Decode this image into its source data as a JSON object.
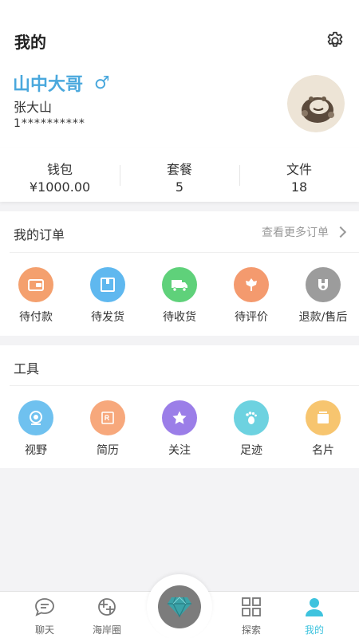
{
  "header": {
    "title": "我的",
    "settings_icon": "gear-icon"
  },
  "profile": {
    "nickname": "山中大哥",
    "gender_symbol": "♂",
    "name": "张大山",
    "phone": "1**********",
    "avatar_icon": "avatar"
  },
  "stats": [
    {
      "label": "钱包",
      "value": "¥1000.00"
    },
    {
      "label": "套餐",
      "value": "5"
    },
    {
      "label": "文件",
      "value": "18"
    }
  ],
  "orders": {
    "title": "我的订单",
    "more_label": "查看更多订单",
    "items": [
      {
        "label": "待付款",
        "icon": "wallet-icon",
        "color": "#f4a06e"
      },
      {
        "label": "待发货",
        "icon": "package-icon",
        "color": "#5fb8ef"
      },
      {
        "label": "待收货",
        "icon": "truck-icon",
        "color": "#5fd17a"
      },
      {
        "label": "待评价",
        "icon": "flower-icon",
        "color": "#f49a6e"
      },
      {
        "label": "退款/售后",
        "icon": "refund-icon",
        "color": "#9c9c9c"
      }
    ]
  },
  "tools": {
    "title": "工具",
    "items": [
      {
        "label": "视野",
        "icon": "camera-icon",
        "color": "#6fc1ef"
      },
      {
        "label": "简历",
        "icon": "resume-icon",
        "color": "#f7a87c"
      },
      {
        "label": "关注",
        "icon": "star-icon",
        "color": "#9b7ee8"
      },
      {
        "label": "足迹",
        "icon": "footprint-icon",
        "color": "#6dd2e0"
      },
      {
        "label": "名片",
        "icon": "card-icon",
        "color": "#f7c56f"
      }
    ]
  },
  "tabbar": {
    "items": [
      {
        "label": "聊天",
        "icon": "chat-icon"
      },
      {
        "label": "海岸圈",
        "icon": "shutter-icon"
      },
      {
        "label": "探索",
        "icon": "grid-icon"
      },
      {
        "label": "我的",
        "icon": "user-icon"
      }
    ],
    "center_icon": "diamond-icon",
    "active_color": "#3ec3de"
  }
}
